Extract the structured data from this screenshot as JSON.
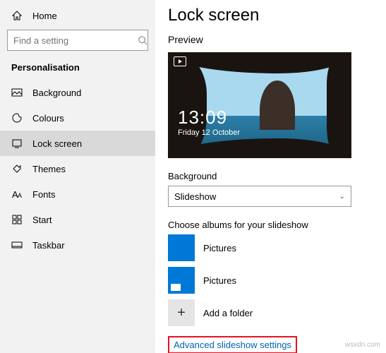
{
  "sidebar": {
    "home": "Home",
    "search_placeholder": "Find a setting",
    "section": "Personalisation",
    "items": [
      {
        "label": "Background"
      },
      {
        "label": "Colours"
      },
      {
        "label": "Lock screen"
      },
      {
        "label": "Themes"
      },
      {
        "label": "Fonts"
      },
      {
        "label": "Start"
      },
      {
        "label": "Taskbar"
      }
    ]
  },
  "main": {
    "title": "Lock screen",
    "preview_label": "Preview",
    "clock_time": "13:09",
    "clock_date": "Friday 12 October",
    "background_label": "Background",
    "background_value": "Slideshow",
    "albums_label": "Choose albums for your slideshow",
    "albums": [
      {
        "label": "Pictures"
      },
      {
        "label": "Pictures"
      }
    ],
    "add_folder": "Add a folder",
    "advanced_link": "Advanced slideshow settings"
  },
  "watermark": "wsxdn.com"
}
